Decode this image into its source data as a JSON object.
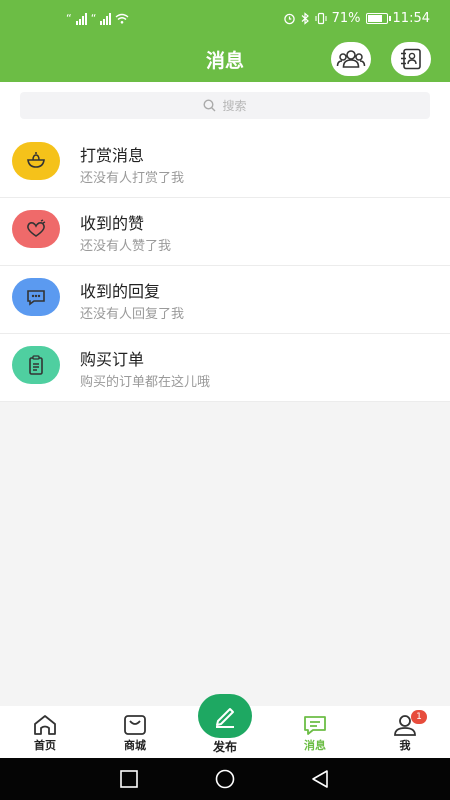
{
  "status_bar": {
    "carrier_left": "“",
    "carrier_right": "“",
    "battery_percent": "71%",
    "time": "11:54"
  },
  "header": {
    "title": "消息",
    "group_icon": "group-icon",
    "contacts_icon": "contacts-icon"
  },
  "search": {
    "placeholder": "搜索"
  },
  "messages": [
    {
      "title": "打赏消息",
      "subtitle": "还没有人打赏了我",
      "icon": "tip-icon",
      "color": "#f5c21a"
    },
    {
      "title": "收到的赞",
      "subtitle": "还没有人赞了我",
      "icon": "heart-icon",
      "color": "#ef6a6a"
    },
    {
      "title": "收到的回复",
      "subtitle": "还没有人回复了我",
      "icon": "comment-icon",
      "color": "#5b9af0"
    },
    {
      "title": "购买订单",
      "subtitle": "购买的订单都在这儿哦",
      "icon": "clipboard-icon",
      "color": "#4fcfa0"
    }
  ],
  "bottom_nav": {
    "home": "首页",
    "shop": "商城",
    "publish": "发布",
    "messages": "消息",
    "me": "我",
    "me_badge": "1"
  },
  "colors": {
    "brand": "#6cbd45",
    "publish": "#1ea862",
    "badge": "#e74c3c"
  }
}
